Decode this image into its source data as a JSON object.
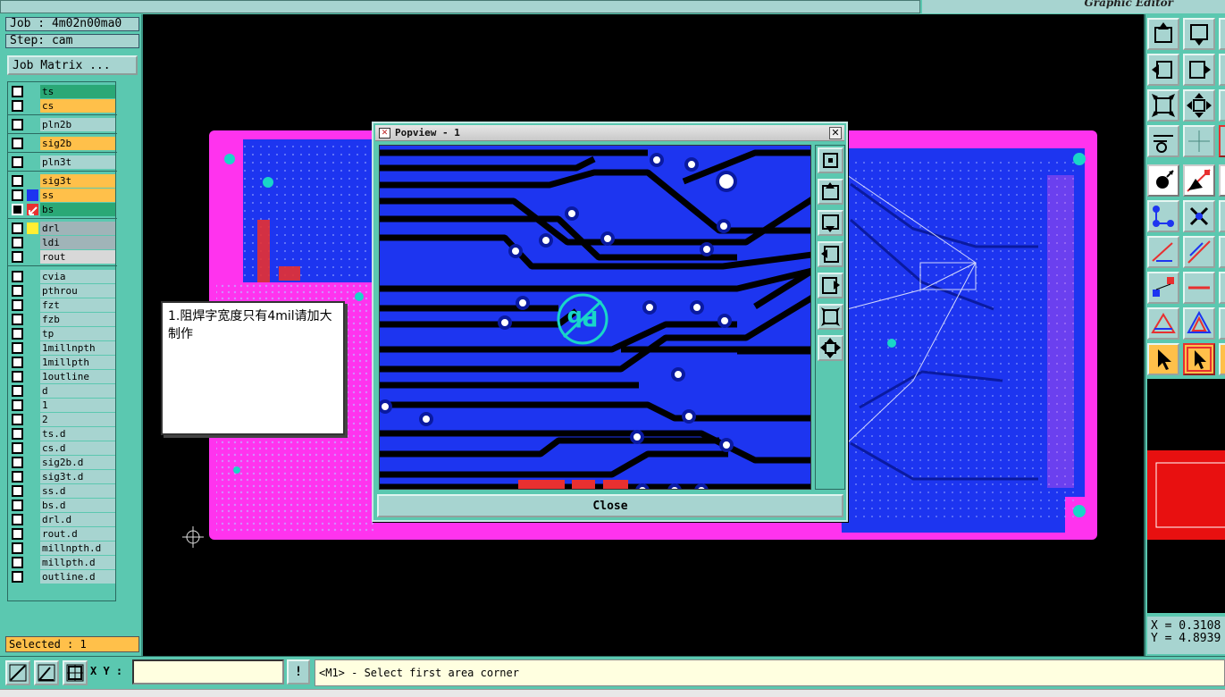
{
  "window": {
    "title": "Graphic Editor"
  },
  "job": {
    "job_line": "Job : 4m02n00ma0",
    "step_line": "Step: cam",
    "matrix_button": "Job Matrix ..."
  },
  "layers": [
    {
      "name": "ts",
      "color": "#2aa876",
      "swatch": null
    },
    {
      "name": "cs",
      "color": "#ffc04a",
      "swatch": null
    },
    {
      "name": "pln2b",
      "color": "#a7d4d0",
      "swatch": null
    },
    {
      "name": "sig2b",
      "color": "#ffc04a",
      "swatch": null
    },
    {
      "name": "pln3t",
      "color": "#a7d4d0",
      "swatch": null
    },
    {
      "name": "sig3t",
      "color": "#ffc04a",
      "swatch": null
    },
    {
      "name": "ss",
      "color": "#ffc04a",
      "swatch": "#1d35f0"
    },
    {
      "name": "bs",
      "color": "#2aa876",
      "swatch": "#e83030",
      "active": true
    },
    {
      "name": "drl",
      "color": "#a0b4b8",
      "swatch": "#ffee33"
    },
    {
      "name": "ldi",
      "color": "#a0b4b8",
      "swatch": null
    },
    {
      "name": "rout",
      "color": "#d8d8d8",
      "swatch": null
    },
    {
      "name": "cvia",
      "color": "#a7d4d0",
      "swatch": null
    },
    {
      "name": "pthrou",
      "color": "#a7d4d0",
      "swatch": null
    },
    {
      "name": "fzt",
      "color": "#a7d4d0",
      "swatch": null
    },
    {
      "name": "fzb",
      "color": "#a7d4d0",
      "swatch": null
    },
    {
      "name": "tp",
      "color": "#a7d4d0",
      "swatch": null
    },
    {
      "name": "1millnpth",
      "color": "#a7d4d0",
      "swatch": null
    },
    {
      "name": "1millpth",
      "color": "#a7d4d0",
      "swatch": null
    },
    {
      "name": "1outline",
      "color": "#a7d4d0",
      "swatch": null
    },
    {
      "name": "d",
      "color": "#a7d4d0",
      "swatch": null
    },
    {
      "name": "1",
      "color": "#a7d4d0",
      "swatch": null
    },
    {
      "name": "2",
      "color": "#a7d4d0",
      "swatch": null
    },
    {
      "name": "ts.d",
      "color": "#a7d4d0",
      "swatch": null
    },
    {
      "name": "cs.d",
      "color": "#a7d4d0",
      "swatch": null
    },
    {
      "name": "sig2b.d",
      "color": "#a7d4d0",
      "swatch": null
    },
    {
      "name": "sig3t.d",
      "color": "#a7d4d0",
      "swatch": null
    },
    {
      "name": "ss.d",
      "color": "#a7d4d0",
      "swatch": null
    },
    {
      "name": "bs.d",
      "color": "#a7d4d0",
      "swatch": null
    },
    {
      "name": "drl.d",
      "color": "#a7d4d0",
      "swatch": null
    },
    {
      "name": "rout.d",
      "color": "#a7d4d0",
      "swatch": null
    },
    {
      "name": "millnpth.d",
      "color": "#a7d4d0",
      "swatch": null
    },
    {
      "name": "millpth.d",
      "color": "#a7d4d0",
      "swatch": null
    },
    {
      "name": "outline.d",
      "color": "#a7d4d0",
      "swatch": null
    }
  ],
  "selected": {
    "label": "Selected : 1"
  },
  "note": {
    "text": "1.阻焊字宽度只有4mil请加大制作"
  },
  "popview": {
    "title": "Popview - 1",
    "close_x": "✕",
    "close_button": "Close",
    "pb_label": "Pb"
  },
  "coords": {
    "x_line": "X = 0.3108",
    "y_line": "Y = 4.8939"
  },
  "status": {
    "xy_label": "X Y :",
    "xy_value": "",
    "excl": "!",
    "prompt": "<M1> - Select first area corner"
  },
  "colors": {
    "panel": "#5bc8b0",
    "button": "#a7d4d0",
    "board_pink": "#ff33ee",
    "board_blue": "#1d35f0",
    "pad_cyan": "#19d6c8"
  }
}
